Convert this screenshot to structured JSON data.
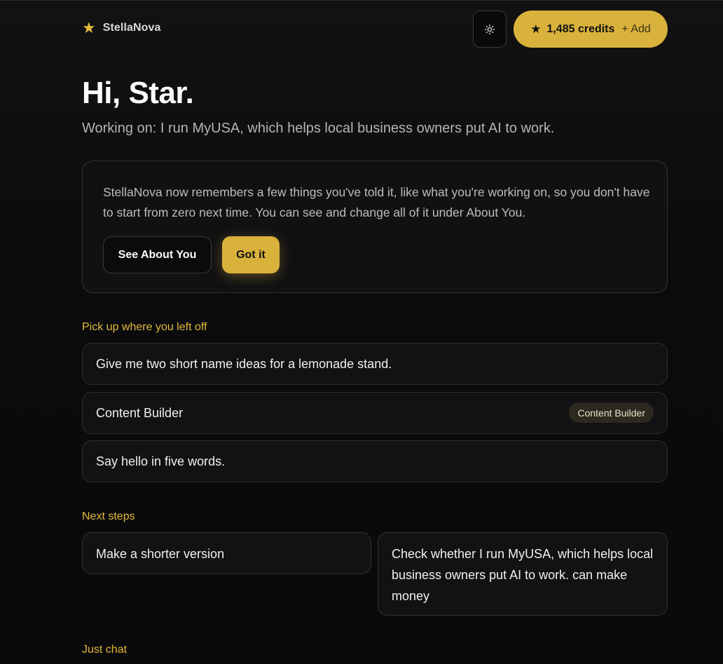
{
  "header": {
    "brand_name": "StellaNova",
    "credits_amount": "1,485 credits",
    "credits_add": "+ Add",
    "accent_color": "#d9b23c"
  },
  "greeting": {
    "title": "Hi, Star.",
    "working_on": "Working on: I run MyUSA, which helps local business owners put AI to work."
  },
  "notice": {
    "text": "StellaNova now remembers a few things you've told it, like what you're working on, so you don't have to start from zero next time. You can see and change all of it under About You.",
    "see_about_label": "See About You",
    "got_it_label": "Got it"
  },
  "pickup": {
    "title": "Pick up where you left off",
    "items": [
      {
        "label": "Give me two short name ideas for a lemonade stand."
      },
      {
        "label": "Content Builder",
        "tag": "Content Builder"
      },
      {
        "label": "Say hello in five words."
      }
    ]
  },
  "next_steps": {
    "title": "Next steps",
    "items": [
      {
        "label": "Make a shorter version"
      },
      {
        "label": "Check whether I run MyUSA, which helps local business owners put AI to work. can make money"
      }
    ]
  },
  "just_chat": {
    "title": "Just chat"
  }
}
